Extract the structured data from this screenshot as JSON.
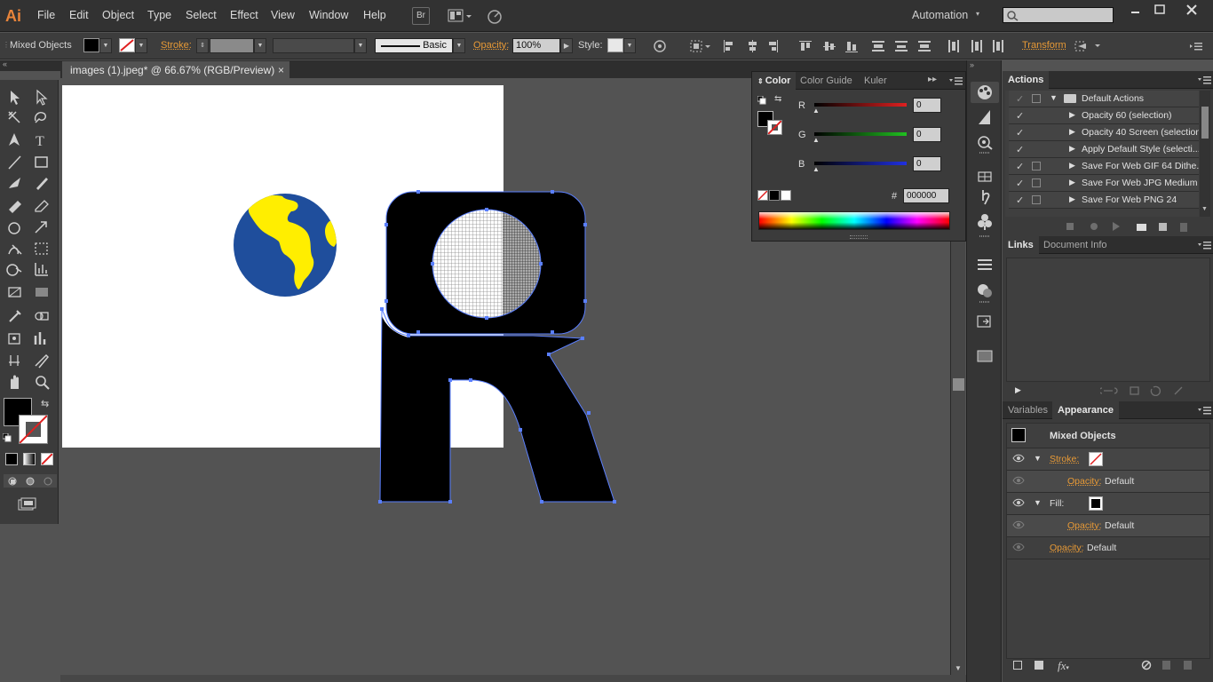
{
  "app": {
    "logo": "Ai"
  },
  "menu": [
    "File",
    "Edit",
    "Object",
    "Type",
    "Select",
    "Effect",
    "View",
    "Window",
    "Help"
  ],
  "menu_buttons": {
    "bridge": "Br"
  },
  "workspace": {
    "label": "Automation"
  },
  "control_bar": {
    "selection": "Mixed Objects",
    "stroke_label": "Stroke:",
    "brush_label": "Basic",
    "opacity_label": "Opacity:",
    "opacity_value": "100%",
    "style_label": "Style:",
    "transform_label": "Transform"
  },
  "document_tab": {
    "title": "images (1).jpeg* @ 66.67% (RGB/Preview)",
    "close": "×"
  },
  "color_panel": {
    "tabs": [
      "Color",
      "Color Guide",
      "Kuler"
    ],
    "channels": [
      {
        "label": "R",
        "value": "0",
        "color": "#e02020"
      },
      {
        "label": "G",
        "value": "0",
        "color": "#20c020"
      },
      {
        "label": "B",
        "value": "0",
        "color": "#2030e0"
      }
    ],
    "hex_label": "#",
    "hex_value": "000000"
  },
  "actions_panel": {
    "tab": "Actions",
    "set_name": "Default Actions",
    "items": [
      "Opacity 60 (selection)",
      "Opacity 40 Screen (selection)",
      "Apply Default Style (selecti...",
      "Save For Web GIF 64 Dithe...",
      "Save For Web JPG Medium",
      "Save For Web PNG 24"
    ]
  },
  "links_panel": {
    "tabs": [
      "Links",
      "Document Info"
    ]
  },
  "appearance_panel": {
    "tabs": [
      "Variables",
      "Appearance"
    ],
    "title": "Mixed Objects",
    "stroke_label": "Stroke:",
    "fill_label": "Fill:",
    "opacity_label": "Opacity:",
    "default_value": "Default",
    "fx_label": "fx"
  },
  "colors": {
    "accent": "#e89a36",
    "globe_blue": "#1f4e9c",
    "globe_yellow": "#ffee00",
    "selection": "#5a7fff"
  }
}
